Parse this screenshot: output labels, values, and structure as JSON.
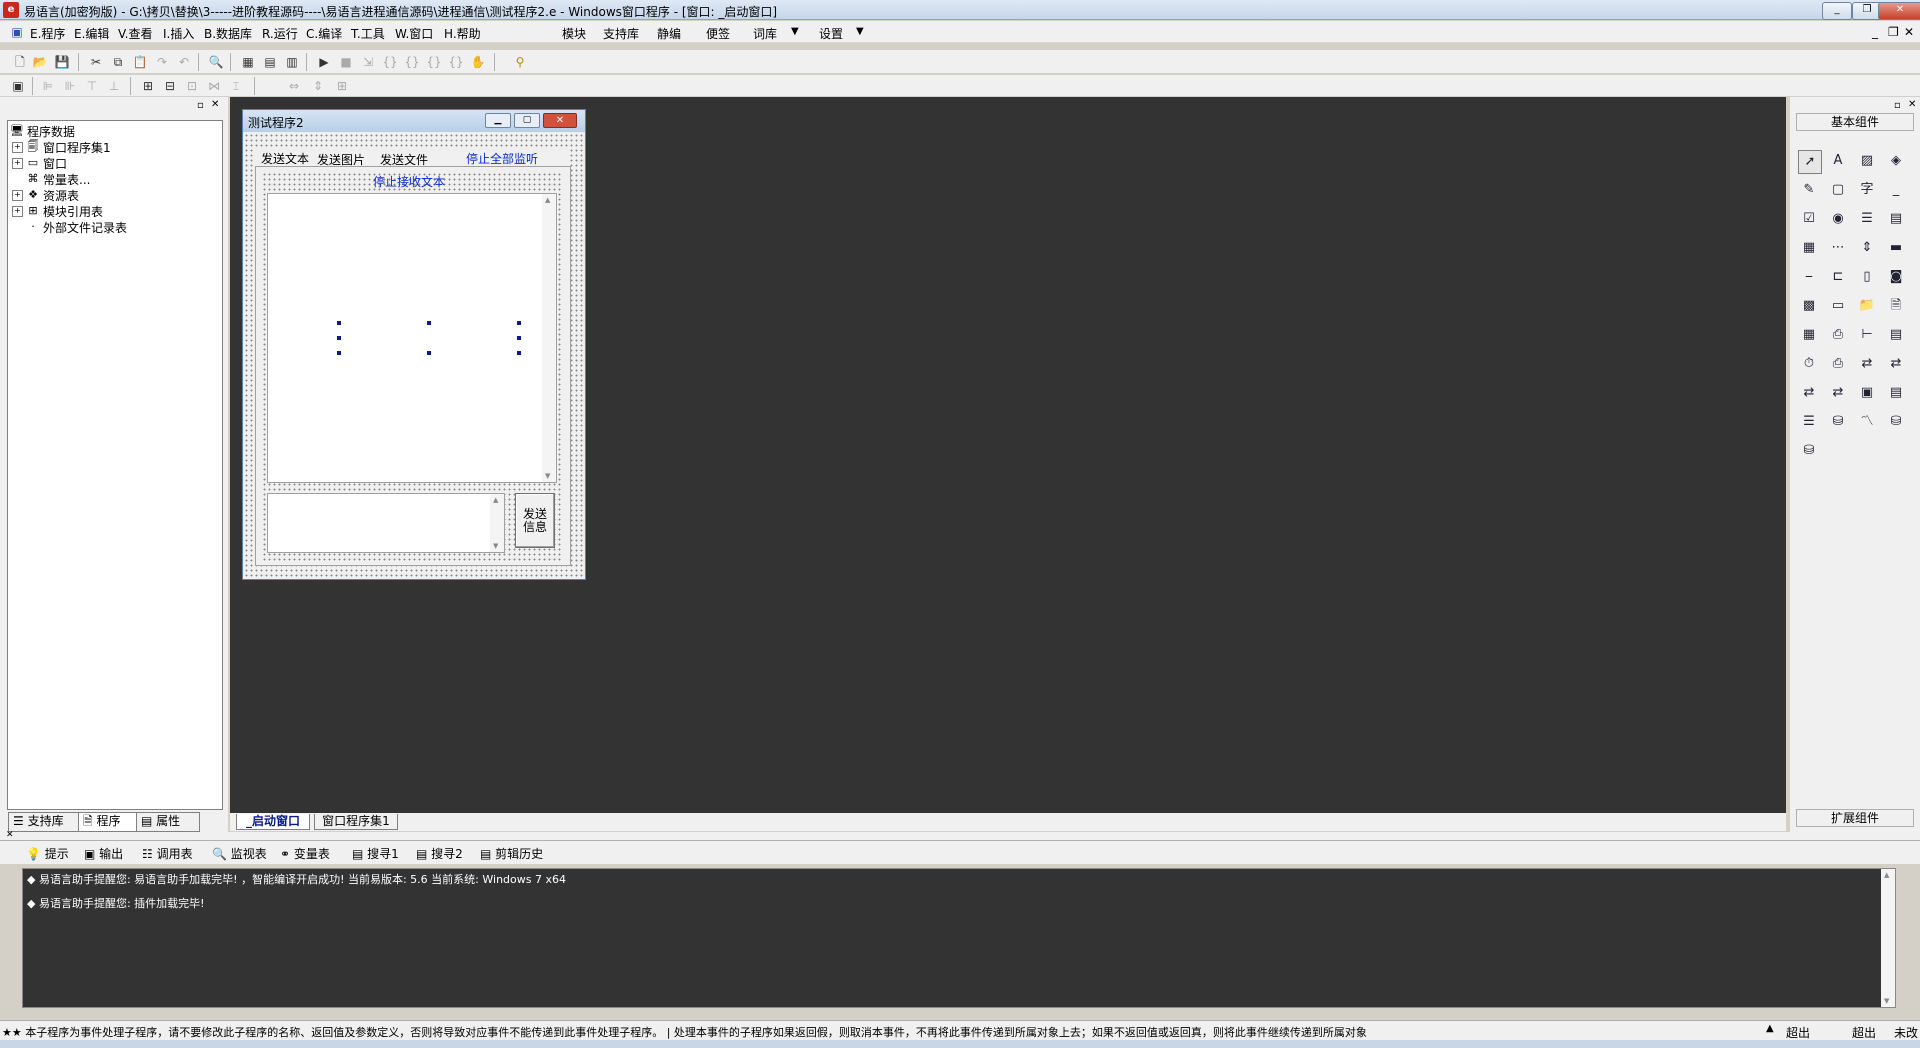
{
  "window": {
    "title": "易语言(加密狗版) - G:\\拷贝\\替换\\3-----进阶教程源码----\\易语言进程通信源码\\进程通信\\测试程序2.e - Windows窗口程序 - [窗口: _启动窗口]"
  },
  "menu": {
    "program": "E.程序",
    "edit": "E.编辑",
    "view": "V.查看",
    "insert": "I.插入",
    "database": "B.数据库",
    "run": "R.运行",
    "compile": "C.编译",
    "tools": "T.工具",
    "window": "W.窗口",
    "help": "H.帮助",
    "module": "模块",
    "support_lib": "支持库",
    "static": "静编",
    "note": "便签",
    "dictionary": "词库",
    "settings": "设置"
  },
  "tree": {
    "root": "程序数据",
    "items": [
      "窗口程序集1",
      "窗口",
      "常量表...",
      "资源表",
      "模块引用表",
      "外部文件记录表"
    ]
  },
  "left_tabs": [
    "支持库",
    "程序",
    "属性"
  ],
  "form": {
    "title": "测试程序2",
    "tabs": [
      "发送文本",
      "发送图片",
      "发送文件"
    ],
    "stop_all_label": "停止全部监听",
    "stop_receive_label": "停止接收文本",
    "send_button": "发送\n信息"
  },
  "designer_tabs": [
    "_启动窗口",
    "窗口程序集1"
  ],
  "right_panel": {
    "header": "基本组件",
    "footer": "扩展组件",
    "icons": [
      "pointer-icon",
      "label-icon",
      "image-icon",
      "shape-icon",
      "edit-icon",
      "frame-icon",
      "font-icon",
      "line-icon",
      "checkbox-icon",
      "radio-icon",
      "listbox-icon",
      "combobox-icon",
      "table-icon",
      "ruler-icon",
      "scroll-icon",
      "bar-icon",
      "hline-icon",
      "box-icon",
      "vbox-icon",
      "picturebox-icon",
      "calendar-icon",
      "drive-icon",
      "folder-icon",
      "file-icon",
      "grid-icon",
      "printer-icon",
      "tree-icon",
      "listview-icon",
      "timer-icon",
      "print-icon",
      "db1-icon",
      "db2-icon",
      "db3-icon",
      "db4-icon",
      "db5-icon",
      "db6-icon",
      "db7-icon",
      "db8-icon",
      "chart-icon",
      "odbc-icon",
      "odbc2-icon"
    ]
  },
  "output_tabs": [
    "提示",
    "输出",
    "调用表",
    "监视表",
    "变量表",
    "搜寻1",
    "搜寻2",
    "剪辑历史"
  ],
  "output_lines": [
    "易语言助手提醒您: 易语言助手加载完毕! ，智能编译开启成功! 当前易版本: 5.6 当前系统: Windows 7 x64",
    "易语言助手提醒您: 插件加载完毕!"
  ],
  "status": {
    "text": "★★ 本子程序为事件处理子程序，请不要修改此子程序的名称、返回值及参数定义，否则将导致对应事件不能传递到此事件处理子程序。 | 处理本事件的子程序如果返回假，则取消本事件，不再将此事件传递到所属对象上去；如果不返回值或返回真，则将此事件继续传递到所属对象",
    "cell1": "超出",
    "cell2": "超出",
    "cell3": "未改"
  }
}
